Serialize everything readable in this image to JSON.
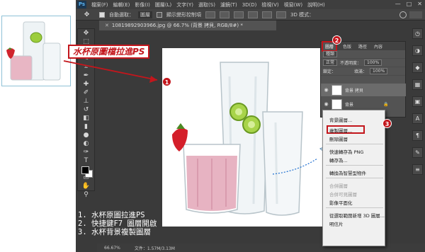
{
  "annotation": {
    "drag_instruction": "水杯原圖檔拉進PS",
    "badges": [
      "1",
      "2",
      "3"
    ]
  },
  "photoshop": {
    "logo": "Ps",
    "menu": [
      "檔案(F)",
      "編輯(E)",
      "影像(I)",
      "圖層(L)",
      "文字(Y)",
      "選取(S)",
      "濾鏡(T)",
      "3D(D)",
      "檢視(V)",
      "視窗(W)",
      "說明(H)"
    ],
    "window_buttons": [
      "—",
      "□",
      "✕"
    ],
    "options_bar": {
      "auto_select_label": "自動選取：",
      "auto_select_value": "圖層",
      "show_transform_label": "顯示變形控制項",
      "mode_3d_label": "3D 模式："
    },
    "document_tab": "10819892903966.jpg @ 66.7% (背景 拷貝, RGB/8#) *",
    "status": {
      "zoom": "66.67%",
      "doc_size": "文件：1.57M/3.13M"
    },
    "layers_panel": {
      "tabs": [
        "圖層",
        "色版",
        "路徑",
        "內容"
      ],
      "filter_label": "種類",
      "blend_mode": "正常",
      "opacity_label": "不透明度：",
      "opacity_value": "100%",
      "lock_label": "鎖定：",
      "fill_label": "填滿：",
      "fill_value": "100%",
      "layers": [
        {
          "name": "背景 拷貝",
          "selected": true
        },
        {
          "name": "背景",
          "selected": false
        }
      ]
    },
    "context_menu": {
      "items": [
        {
          "label": "背景圖層...",
          "disabled": false
        },
        {
          "label": "複製圖層...",
          "disabled": false
        },
        {
          "label": "刪除圖層",
          "disabled": false
        },
        {
          "label": "快速轉存為 PNG",
          "disabled": false
        },
        {
          "label": "轉存為...",
          "disabled": false
        },
        {
          "label": "轉換為智慧型物件",
          "disabled": false
        },
        {
          "label": "合併圖層",
          "disabled": true
        },
        {
          "label": "合併可見圖層",
          "disabled": true
        },
        {
          "label": "影像平面化",
          "disabled": false
        },
        {
          "label": "從選取範圍新增 3D 圖層...",
          "disabled": false
        },
        {
          "label": "明信片",
          "disabled": false
        }
      ]
    }
  },
  "steps": [
    "1. 水杯原圖拉進PS",
    "2. 快捷鍵F7 圖層開啟",
    "3. 水杯背景複製圖層"
  ],
  "colors": {
    "annotation_red": "#c3161c",
    "ps_dark": "#3a3a3a",
    "thumb_border": "#8fc1d6"
  }
}
